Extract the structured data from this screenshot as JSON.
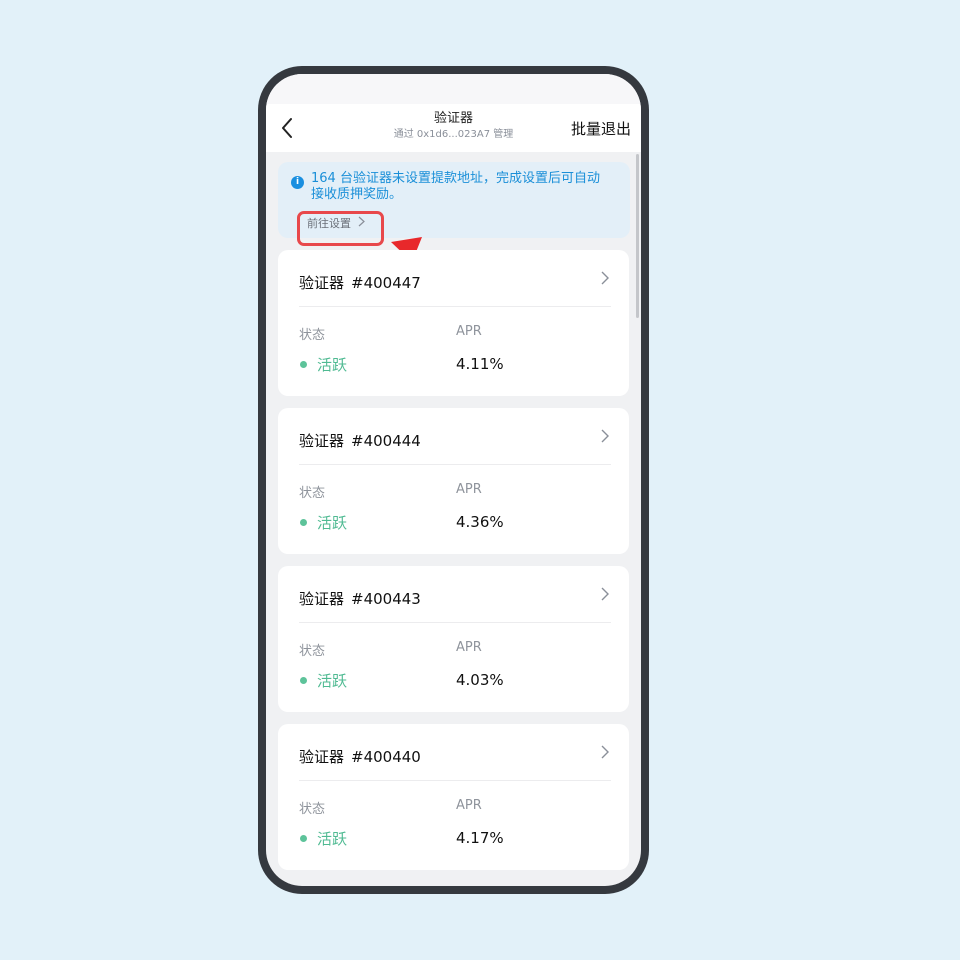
{
  "header": {
    "title": "验证器",
    "subtitle": "通过 0x1d6...023A7 管理",
    "batch_exit_label": "批量退出"
  },
  "notice": {
    "icon": "info-icon",
    "text": "164 台验证器未设置提款地址，完成设置后可自动接收质押奖励。",
    "action_label": "前往设置"
  },
  "colors": {
    "accent_blue": "#1a8fd8",
    "active_green": "#4fba92",
    "highlight_red": "#e8484b"
  },
  "cards": [
    {
      "title": "验证器",
      "id": "#400447",
      "status_label": "状态",
      "status": "活跃",
      "apr_label": "APR",
      "apr": "4.11%"
    },
    {
      "title": "验证器",
      "id": "#400444",
      "status_label": "状态",
      "status": "活跃",
      "apr_label": "APR",
      "apr": "4.36%"
    },
    {
      "title": "验证器",
      "id": "#400443",
      "status_label": "状态",
      "status": "活跃",
      "apr_label": "APR",
      "apr": "4.03%"
    },
    {
      "title": "验证器",
      "id": "#400440",
      "status_label": "状态",
      "status": "活跃",
      "apr_label": "APR",
      "apr": "4.17%"
    }
  ]
}
